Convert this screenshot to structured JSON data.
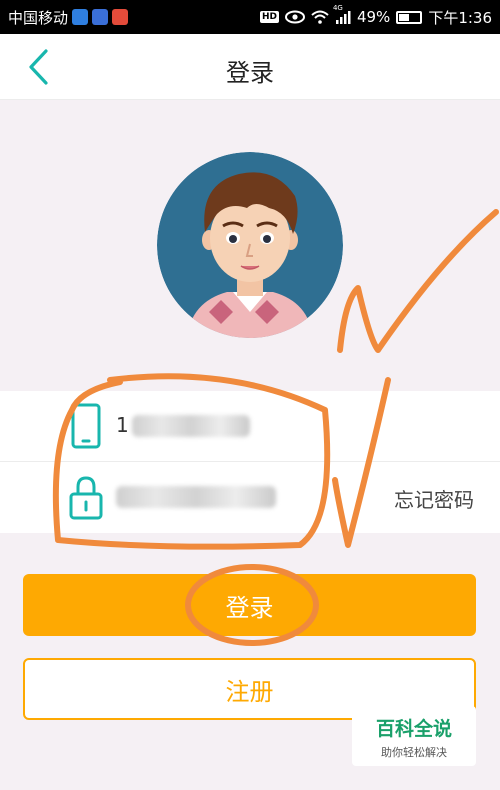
{
  "status_bar": {
    "carrier": "中国移动",
    "hd": "HD",
    "network": "4G",
    "battery": "49%",
    "battery_level": 0.49,
    "time": "下午1:36"
  },
  "header": {
    "title": "登录"
  },
  "form": {
    "phone_prefix": "1",
    "forgot_label": "忘记密码"
  },
  "buttons": {
    "login_label": "登录",
    "register_label": "注册"
  },
  "watermark": {
    "title": "百科全说",
    "subtitle": "助你轻松解决"
  },
  "colors": {
    "accent": "#fea902",
    "teal": "#18b6ad",
    "annotation": "#f08a3c"
  }
}
